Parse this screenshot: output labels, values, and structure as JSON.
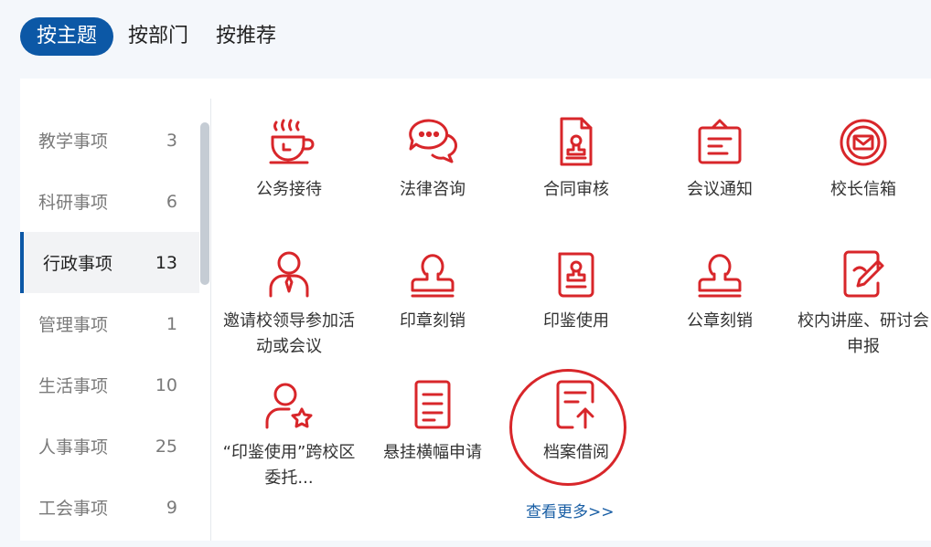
{
  "tabs": [
    {
      "label": "按主题",
      "active": true
    },
    {
      "label": "按部门",
      "active": false
    },
    {
      "label": "按推荐",
      "active": false
    }
  ],
  "sidebar": {
    "items": [
      {
        "label": "教学事项",
        "count": "3"
      },
      {
        "label": "科研事项",
        "count": "6"
      },
      {
        "label": "行政事项",
        "count": "13",
        "active": true
      },
      {
        "label": "管理事项",
        "count": "1"
      },
      {
        "label": "生活事项",
        "count": "10"
      },
      {
        "label": "人事事项",
        "count": "25"
      },
      {
        "label": "工会事项",
        "count": "9"
      }
    ]
  },
  "services": [
    {
      "label": "公务接待",
      "icon": "coffee-cup-icon"
    },
    {
      "label": "法律咨询",
      "icon": "chat-bubbles-icon"
    },
    {
      "label": "合同审核",
      "icon": "contract-stamp-icon"
    },
    {
      "label": "会议通知",
      "icon": "notice-board-icon"
    },
    {
      "label": "校长信箱",
      "icon": "mail-circle-icon"
    },
    {
      "label": "邀请校领导参加活动或会议",
      "icon": "leader-person-icon"
    },
    {
      "label": "印章刻销",
      "icon": "stamp-icon"
    },
    {
      "label": "印鉴使用",
      "icon": "seal-document-icon"
    },
    {
      "label": "公章刻销",
      "icon": "stamp-icon"
    },
    {
      "label": "校内讲座、研讨会申报",
      "icon": "lecture-report-icon"
    },
    {
      "label": "“印鉴使用”跨校区委托...",
      "icon": "person-star-icon"
    },
    {
      "label": "悬挂横幅申请",
      "icon": "document-list-icon"
    },
    {
      "label": "档案借阅",
      "icon": "archive-upload-icon"
    }
  ],
  "more_link": "查看更多>>",
  "colors": {
    "accent": "#0c58a6",
    "icon_red": "#d8262a",
    "link": "#1a5fa5"
  }
}
